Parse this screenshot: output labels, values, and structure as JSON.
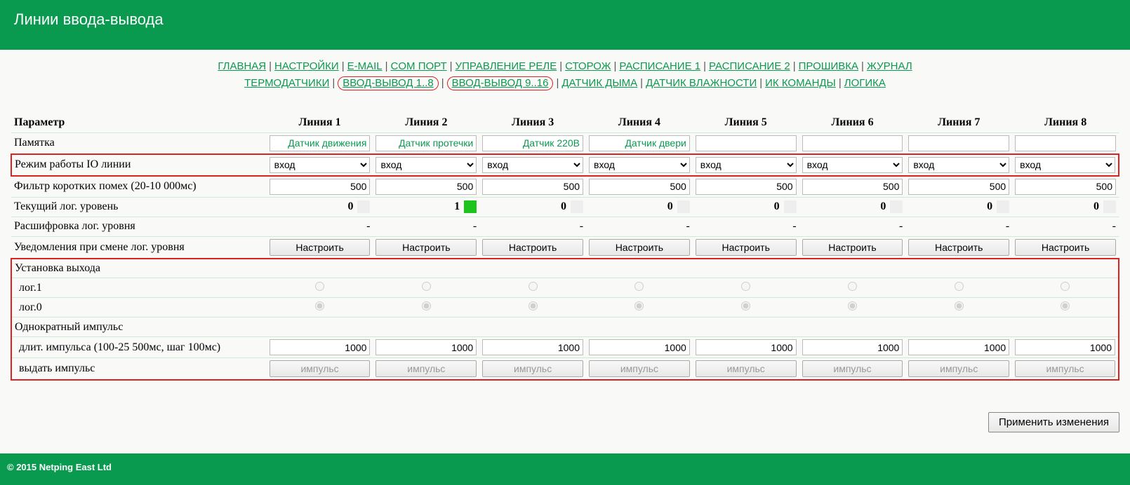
{
  "header": {
    "title": "Линии ввода-вывода"
  },
  "nav": {
    "row1": [
      {
        "label": "ГЛАВНАЯ"
      },
      {
        "label": "НАСТРОЙКИ"
      },
      {
        "label": "E-MAIL"
      },
      {
        "label": "COM ПОРТ"
      },
      {
        "label": "УПРАВЛЕНИЕ РЕЛЕ"
      },
      {
        "label": "СТОРОЖ"
      },
      {
        "label": "РАСПИСАНИЕ 1"
      },
      {
        "label": "РАСПИСАНИЕ 2"
      },
      {
        "label": "ПРОШИВКА"
      },
      {
        "label": "ЖУРНАЛ"
      }
    ],
    "row2": [
      {
        "label": "ТЕРМОДАТЧИКИ"
      },
      {
        "label": "ВВОД-ВЫВОД 1..8",
        "circled": true
      },
      {
        "label": "ВВОД-ВЫВОД 9..16",
        "circled": true
      },
      {
        "label": "ДАТЧИК ДЫМА"
      },
      {
        "label": "ДАТЧИК ВЛАЖНОСТИ"
      },
      {
        "label": "ИК КОМАНДЫ"
      },
      {
        "label": "ЛОГИКА"
      }
    ]
  },
  "table": {
    "header_param": "Параметр",
    "columns": [
      "Линия 1",
      "Линия 2",
      "Линия 3",
      "Линия 4",
      "Линия 5",
      "Линия 6",
      "Линия 7",
      "Линия 8"
    ],
    "rows": {
      "memo_label": "Памятка",
      "memo": [
        "Датчик движения",
        "Датчик протечки",
        "Датчик 220В",
        "Датчик двери",
        "",
        "",
        "",
        ""
      ],
      "mode_label": "Режим работы IO линии",
      "mode": [
        "вход",
        "вход",
        "вход",
        "вход",
        "вход",
        "вход",
        "вход",
        "вход"
      ],
      "filter_label": "Фильтр коротких помех (20-10 000мс)",
      "filter": [
        "500",
        "500",
        "500",
        "500",
        "500",
        "500",
        "500",
        "500"
      ],
      "level_label": "Текущий лог. уровень",
      "level": [
        0,
        1,
        0,
        0,
        0,
        0,
        0,
        0
      ],
      "decode_label": "Расшифровка лог. уровня",
      "decode": [
        "-",
        "-",
        "-",
        "-",
        "-",
        "-",
        "-",
        "-"
      ],
      "notify_label": "Уведомления при смене лог. уровня",
      "notify_btn": "Настроить",
      "set_out_label": "Установка выхода",
      "log1_label": "лог.1",
      "log0_label": "лог.0",
      "out_selected": [
        0,
        0,
        0,
        0,
        0,
        0,
        0,
        0
      ],
      "pulse_label": "Однократный импульс",
      "dur_label": "длит. импульса (100-25 500мс, шаг 100мс)",
      "dur": [
        "1000",
        "1000",
        "1000",
        "1000",
        "1000",
        "1000",
        "1000",
        "1000"
      ],
      "emit_label": "выдать импульс",
      "emit_btn": "импульс"
    }
  },
  "apply": {
    "label": "Применить изменения"
  },
  "footer": {
    "text": "© 2015 Netping East Ltd"
  }
}
